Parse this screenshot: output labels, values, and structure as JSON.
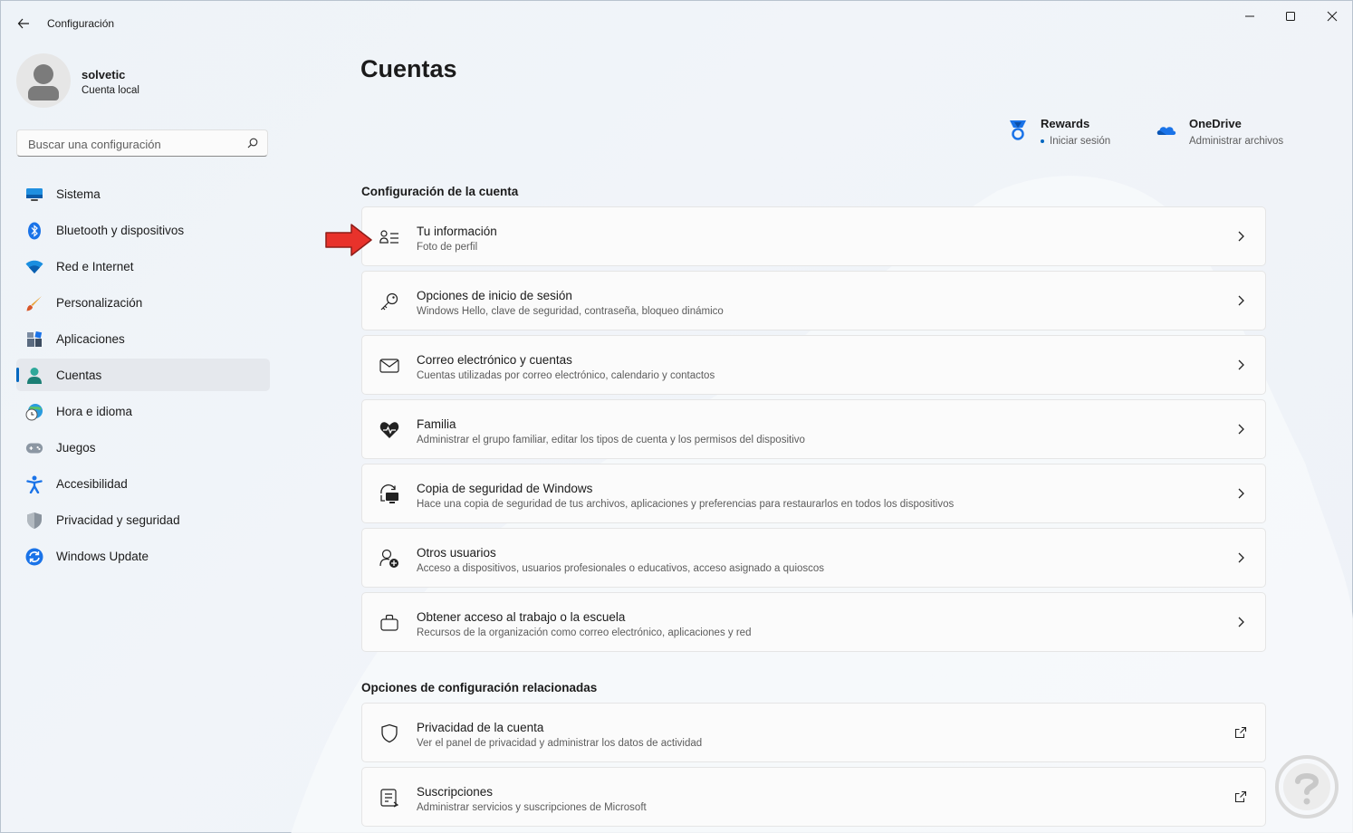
{
  "window": {
    "title": "Configuración"
  },
  "profile": {
    "name": "solvetic",
    "type": "Cuenta local"
  },
  "search": {
    "placeholder": "Buscar una configuración"
  },
  "nav": [
    {
      "label": "Sistema",
      "icon": "monitor-icon"
    },
    {
      "label": "Bluetooth y dispositivos",
      "icon": "bluetooth-icon"
    },
    {
      "label": "Red e Internet",
      "icon": "wifi-icon"
    },
    {
      "label": "Personalización",
      "icon": "brush-icon"
    },
    {
      "label": "Aplicaciones",
      "icon": "apps-icon"
    },
    {
      "label": "Cuentas",
      "icon": "person-icon",
      "active": true
    },
    {
      "label": "Hora e idioma",
      "icon": "clock-globe-icon"
    },
    {
      "label": "Juegos",
      "icon": "gamepad-icon"
    },
    {
      "label": "Accesibilidad",
      "icon": "accessibility-icon"
    },
    {
      "label": "Privacidad y seguridad",
      "icon": "shield-icon"
    },
    {
      "label": "Windows Update",
      "icon": "update-icon"
    }
  ],
  "main": {
    "title": "Cuentas",
    "services": [
      {
        "name": "Rewards",
        "sub": "Iniciar sesión",
        "icon": "rewards-icon"
      },
      {
        "name": "OneDrive",
        "sub": "Administrar archivos",
        "icon": "onedrive-icon"
      }
    ],
    "section_account": "Configuración de la cuenta",
    "account_cards": [
      {
        "title": "Tu información",
        "sub": "Foto de perfil",
        "icon": "person-info-icon"
      },
      {
        "title": "Opciones de inicio de sesión",
        "sub": "Windows Hello, clave de seguridad, contraseña, bloqueo dinámico",
        "icon": "key-icon"
      },
      {
        "title": "Correo electrónico y cuentas",
        "sub": "Cuentas utilizadas por correo electrónico, calendario y contactos",
        "icon": "mail-icon"
      },
      {
        "title": "Familia",
        "sub": "Administrar el grupo familiar, editar los tipos de cuenta y los permisos del dispositivo",
        "icon": "family-heart-icon"
      },
      {
        "title": "Copia de seguridad de Windows",
        "sub": "Hace una copia de seguridad de tus archivos, aplicaciones y preferencias para restaurarlos en todos los dispositivos",
        "icon": "backup-icon"
      },
      {
        "title": "Otros usuarios",
        "sub": "Acceso a dispositivos, usuarios profesionales o educativos, acceso asignado a quioscos",
        "icon": "add-user-icon"
      },
      {
        "title": "Obtener acceso al trabajo o la escuela",
        "sub": "Recursos de la organización como correo electrónico, aplicaciones y red",
        "icon": "briefcase-icon"
      }
    ],
    "section_related": "Opciones de configuración relacionadas",
    "related_cards": [
      {
        "title": "Privacidad de la cuenta",
        "sub": "Ver el panel de privacidad y administrar los datos de actividad",
        "icon": "shield-outline-icon"
      },
      {
        "title": "Suscripciones",
        "sub": "Administrar servicios y suscripciones de Microsoft",
        "icon": "subscriptions-icon"
      }
    ]
  },
  "colors": {
    "accent": "#0067c0",
    "arrow": "#e8322b"
  }
}
